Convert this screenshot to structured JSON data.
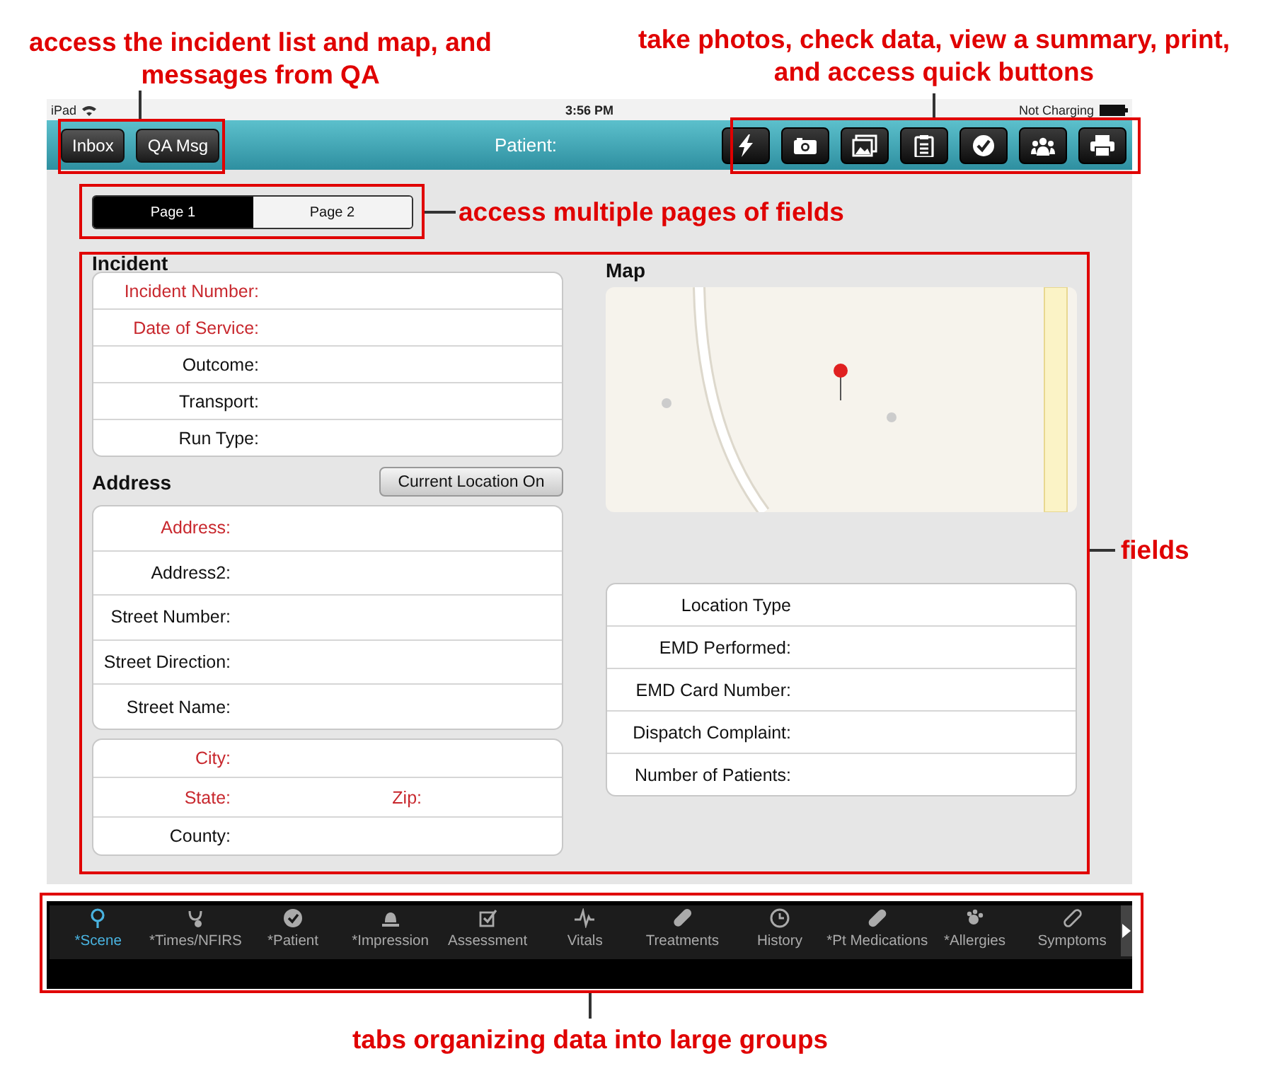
{
  "annotations": [
    {
      "kind": "nav",
      "text": "access the incident list and map, and messages from QA"
    },
    {
      "kind": "tools",
      "text": "take photos, check data, view a summary, print, and access quick buttons"
    },
    {
      "kind": "pages",
      "text": "access multiple pages of fields"
    },
    {
      "kind": "fields",
      "text": "fields"
    },
    {
      "kind": "tabs",
      "text": "tabs organizing data into large groups"
    }
  ],
  "status_bar": {
    "device": "iPad",
    "time": "3:56 PM",
    "battery": "Not Charging"
  },
  "nav_bar": {
    "buttons": [
      "Inbox",
      "QA Msg"
    ],
    "title": "Patient:"
  },
  "page_tabs": [
    {
      "label": "Page 1",
      "selected": true
    },
    {
      "label": "Page 2",
      "selected": false
    }
  ],
  "incident": {
    "title": "Incident",
    "fields": [
      {
        "label": "Incident Number:",
        "required": true
      },
      {
        "label": "Date of Service:",
        "required": true
      },
      {
        "label": "Outcome:",
        "required": false
      },
      {
        "label": "Transport:",
        "required": false
      },
      {
        "label": "Run Type:",
        "required": false
      }
    ]
  },
  "address": {
    "title": "Address",
    "button": "Current Location On",
    "fields": [
      {
        "label": "Address:",
        "required": true
      },
      {
        "label": "Address2:",
        "required": false
      },
      {
        "label": "Street Number:",
        "required": false
      },
      {
        "label": "Street Direction:",
        "required": false
      },
      {
        "label": "Street Name:",
        "required": false
      }
    ],
    "location_rows": [
      [
        {
          "label": "City:",
          "required": true
        }
      ],
      [
        {
          "label": "State:",
          "required": true
        },
        {
          "label": "Zip:",
          "required": true
        }
      ],
      [
        {
          "label": "County:",
          "required": false
        }
      ]
    ]
  },
  "map": {
    "title": "Map"
  },
  "dispatch": {
    "fields": [
      {
        "label": "Location Type",
        "required": false
      },
      {
        "label": "EMD Performed:",
        "required": false
      },
      {
        "label": "EMD Card Number:",
        "required": false
      },
      {
        "label": "Dispatch Complaint:",
        "required": false
      },
      {
        "label": "Number of Patients:",
        "required": false
      }
    ]
  },
  "bottom_tabs": [
    {
      "label": "*Scene",
      "selected": true
    },
    {
      "label": "*Times/NFIRS",
      "selected": false
    },
    {
      "label": "*Patient",
      "selected": false
    },
    {
      "label": "*Impression",
      "selected": false
    },
    {
      "label": "Assessment",
      "selected": false
    },
    {
      "label": "Vitals",
      "selected": false
    },
    {
      "label": "Treatments",
      "selected": false
    },
    {
      "label": "History",
      "selected": false
    },
    {
      "label": "*Pt Medications",
      "selected": false
    },
    {
      "label": "*Allergies",
      "selected": false
    },
    {
      "label": "Symptoms",
      "selected": false
    }
  ]
}
